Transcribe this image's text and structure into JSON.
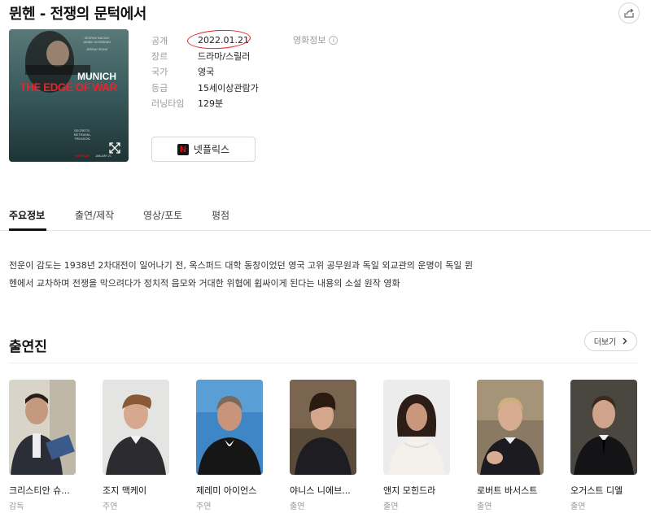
{
  "page": {
    "title": "뮌헨 - 전쟁의 문턱에서"
  },
  "poster": {
    "title_line1": "MUNICH",
    "title_line2": "THE EDGE OF WAR",
    "cast_line1": "GEORGE MACKAY",
    "cast_line2": "JANNIK SCHÜMANN",
    "cast_line3": "JEREMY IRONS",
    "tagline1": "SECRETS.",
    "tagline2": "BETRAYAL.",
    "tagline3": "TREASON.",
    "brand": "NETFLIX",
    "brand_date": "JANUARY 21"
  },
  "info": {
    "rows": [
      {
        "label": "공개",
        "value": "2022.01.21"
      },
      {
        "label": "장르",
        "value": "드라마/스릴러"
      },
      {
        "label": "국가",
        "value": "영국"
      },
      {
        "label": "등급",
        "value": "15세이상관람가"
      },
      {
        "label": "러닝타임",
        "value": "129분"
      }
    ],
    "movie_info_label": "영화정보",
    "info_icon": "i"
  },
  "watch": {
    "netflix_label": "넷플릭스",
    "netflix_logo_letter": "N"
  },
  "tabs": [
    {
      "label": "주요정보"
    },
    {
      "label": "출연/제작"
    },
    {
      "label": "영상/포토"
    },
    {
      "label": "평점"
    }
  ],
  "synopsis": {
    "line1": "전운이 감도는 1938년 2차대전이 일어나기 전, 옥스퍼드 대학 동창이었던 영국 고위 공무원과 독일 외교관의 운명이 독일 뮌",
    "line2": "헨에서 교차하며 전쟁을 막으려다가 정치적 음모와 거대한 위협에 휩싸이게 된다는 내용의 소설 원작 영화"
  },
  "cast": {
    "title": "출연진",
    "more_label": "더보기",
    "members": [
      {
        "name": "크리스티안 슈...",
        "role": "감독"
      },
      {
        "name": "조지 맥케이",
        "role": "주연"
      },
      {
        "name": "제레미 아이언스",
        "role": "주연"
      },
      {
        "name": "야니스 니에브...",
        "role": "출연"
      },
      {
        "name": "앤지 모힌드라",
        "role": "출연"
      },
      {
        "name": "로버트 바서스트",
        "role": "출연"
      },
      {
        "name": "오거스트 디엘",
        "role": "출연"
      }
    ]
  },
  "colors": {
    "accent_red": "#e02020",
    "netflix_red": "#e50914",
    "poster_teal": "#2c4a4c"
  },
  "icons": [
    "share-icon",
    "expand-icon",
    "info-icon",
    "netflix-logo",
    "chevron-right-icon"
  ]
}
